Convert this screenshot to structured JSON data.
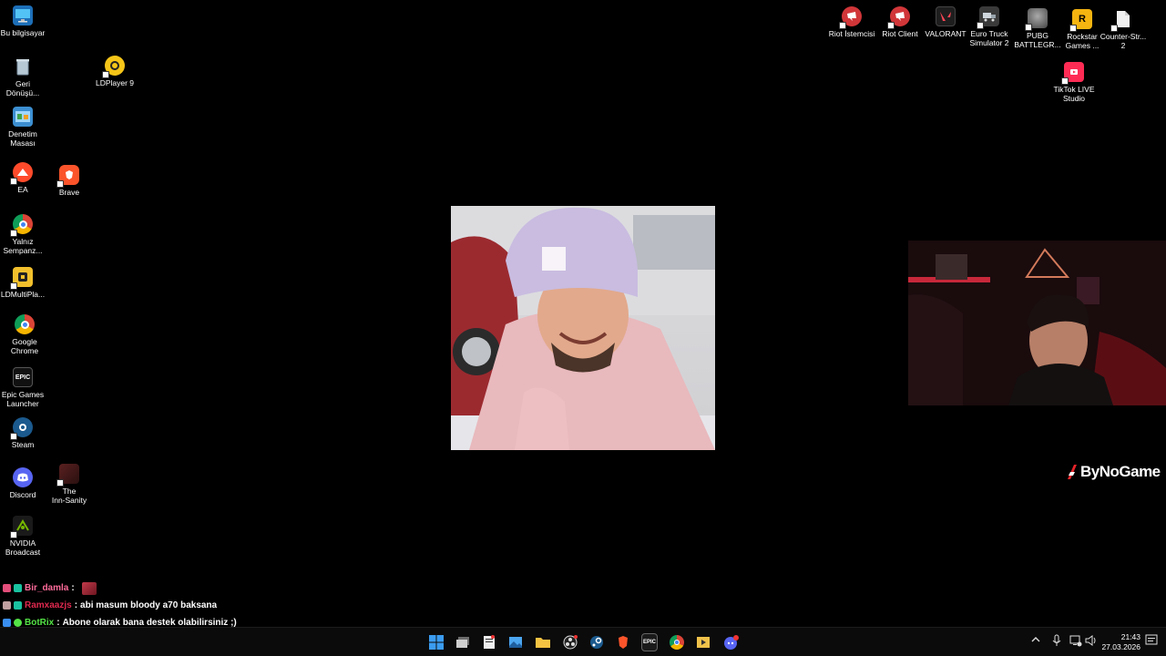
{
  "desktop": {
    "left_icons": [
      {
        "label": "Bu bilgisayar",
        "icon": "computer-icon",
        "color": "#3aa0e8"
      },
      {
        "label": "Geri\nDönüşü...",
        "icon": "recycle-bin-icon",
        "color": "#9fb6c8"
      },
      {
        "label": "Denetim\nMasası",
        "icon": "control-panel-icon",
        "color": "#4fa3d9"
      },
      {
        "label": "EA",
        "icon": "ea-icon",
        "color": "#ff4b2b"
      },
      {
        "label": "Yalnız\nSempanz...",
        "icon": "chrome-icon",
        "color": "#e9b51c"
      },
      {
        "label": "LDMultiPla...",
        "icon": "ldmultiplayer-icon",
        "color": "#f2c02c"
      },
      {
        "label": "Google\nChrome",
        "icon": "chrome-icon",
        "color": "#e9b51c"
      },
      {
        "label": "Epic Games\nLauncher",
        "icon": "epic-games-icon",
        "color": "#2a2a2a"
      },
      {
        "label": "Steam",
        "icon": "steam-icon",
        "color": "#1b5a8e"
      },
      {
        "label": "Discord",
        "icon": "discord-icon",
        "color": "#5865f2"
      },
      {
        "label": "NVIDIA\nBroadcast",
        "icon": "nvidia-broadcast-icon",
        "color": "#76b900"
      }
    ],
    "second_col_icons": [
      {
        "label": "LDPlayer 9",
        "icon": "ldplayer-icon",
        "color": "#f5c518"
      },
      {
        "label": "Brave",
        "icon": "brave-icon",
        "color": "#fb542b"
      },
      {
        "label": "The\nInn-Sanity",
        "icon": "inn-sanity-icon",
        "color": "#6b2a2a"
      }
    ],
    "top_right_icons": [
      {
        "label": "Riot İstemcisi",
        "icon": "riot-client-icon",
        "color": "#d13639"
      },
      {
        "label": "Riot Client",
        "icon": "riot-client-icon",
        "color": "#d13639"
      },
      {
        "label": "VALORANT",
        "icon": "valorant-icon",
        "color": "#ff4655"
      },
      {
        "label": "Euro Truck\nSimulator 2",
        "icon": "euro-truck-icon",
        "color": "#bfc6cc"
      },
      {
        "label": "PUBG\nBATTLEGR...",
        "icon": "pubg-icon",
        "color": "#8b8b8b"
      },
      {
        "label": "Rockstar\nGames ...",
        "icon": "rockstar-icon",
        "color": "#f6b510"
      },
      {
        "label": "Counter-Str...\n2",
        "icon": "file-icon",
        "color": "#f0f0f0"
      }
    ],
    "tiktok_icon": {
      "label": "TikTok LIVE\nStudio",
      "icon": "tiktok-live-icon",
      "color": "#fe2c55"
    }
  },
  "overlay": {
    "brand": "ByNoGame",
    "brand_color": "#ffffff"
  },
  "chat": [
    {
      "user": "Bir_damla",
      "separator": ":",
      "message": "",
      "user_color": "#ff6b9a"
    },
    {
      "user": "Ramxaazjs",
      "separator": ":",
      "message": "abi masum bloody a70 baksana",
      "user_color": "#e0294f"
    },
    {
      "user": "BotRix",
      "separator": ":",
      "message": "Abone olarak bana destek olabilirsiniz ;)",
      "user_color": "#54e346"
    }
  ],
  "taskbar": {
    "apps": [
      {
        "name": "start-button",
        "color": "#3b9cf0"
      },
      {
        "name": "task-view-button",
        "color": "#cfcfcf"
      },
      {
        "name": "notepad-app",
        "color": "#e9e9e9"
      },
      {
        "name": "photos-app",
        "color": "#4ca6f0"
      },
      {
        "name": "file-explorer-app",
        "color": "#f5c342"
      },
      {
        "name": "obs-app",
        "color": "#d9d9d9"
      },
      {
        "name": "steam-app",
        "color": "#1b5a8e"
      },
      {
        "name": "brave-app",
        "color": "#fb542b"
      },
      {
        "name": "epic-games-app",
        "color": "#2a2a2a"
      },
      {
        "name": "chrome-app",
        "color": "#e9b51c"
      },
      {
        "name": "media-app",
        "color": "#f0c24a"
      },
      {
        "name": "discord-app",
        "color": "#5865f2"
      }
    ],
    "time": "21:43",
    "date": "27.03.2026"
  }
}
